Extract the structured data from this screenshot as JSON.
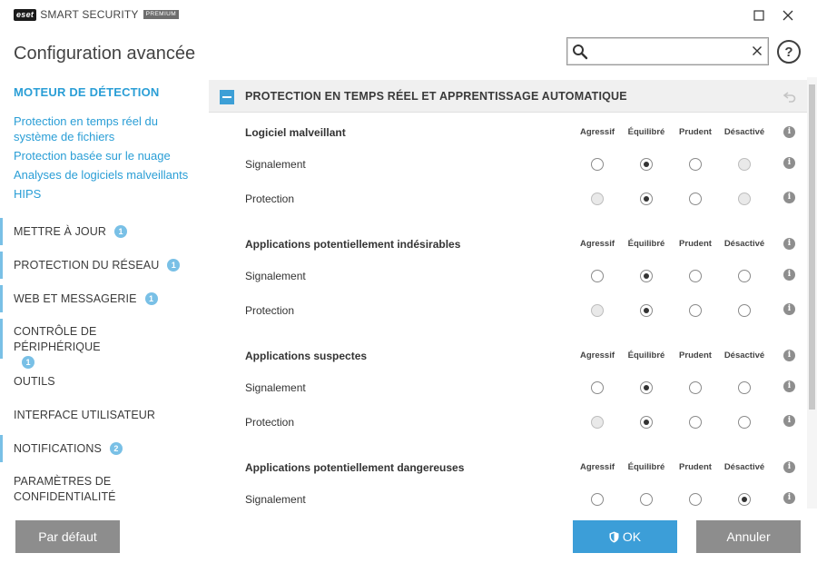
{
  "brand": {
    "logo": "eset",
    "product": "SMART SECURITY",
    "tier": "PREMIUM"
  },
  "window": {
    "maximize_icon": "maximize-icon",
    "close_icon": "close-icon"
  },
  "header": {
    "title": "Configuration avancée",
    "search_value": "",
    "search_placeholder": "",
    "help_label": "?"
  },
  "sidebar": {
    "active_section": "MOTEUR DE DÉTECTION",
    "sub_links": [
      "Protection en temps réel du système de fichiers",
      "Protection basée sur le nuage",
      "Analyses de logiciels malveillants",
      "HIPS"
    ],
    "items": [
      {
        "label": "METTRE À JOUR",
        "badge": "1"
      },
      {
        "label": "PROTECTION DU RÉSEAU",
        "badge": "1"
      },
      {
        "label": "WEB ET MESSAGERIE",
        "badge": "1"
      },
      {
        "label": "CONTRÔLE DE PÉRIPHÉRIQUE",
        "badge": "1"
      },
      {
        "label": "OUTILS",
        "badge": ""
      },
      {
        "label": "INTERFACE UTILISATEUR",
        "badge": ""
      },
      {
        "label": "NOTIFICATIONS",
        "badge": "2"
      },
      {
        "label": "PARAMÈTRES DE CONFIDENTIALITÉ",
        "badge": ""
      }
    ]
  },
  "main": {
    "section_title": "PROTECTION EN TEMPS RÉEL ET APPRENTISSAGE AUTOMATIQUE",
    "columns": [
      "Agressif",
      "Équilibré",
      "Prudent",
      "Désactivé"
    ],
    "info_label": "i",
    "groups": [
      {
        "title": "Logiciel malveillant",
        "rows": [
          {
            "label": "Signalement",
            "selected": 1,
            "disabled": [
              3
            ]
          },
          {
            "label": "Protection",
            "selected": 1,
            "disabled": [
              0,
              3
            ]
          }
        ]
      },
      {
        "title": "Applications potentiellement indésirables",
        "rows": [
          {
            "label": "Signalement",
            "selected": 1,
            "disabled": []
          },
          {
            "label": "Protection",
            "selected": 1,
            "disabled": [
              0
            ]
          }
        ]
      },
      {
        "title": "Applications suspectes",
        "rows": [
          {
            "label": "Signalement",
            "selected": 1,
            "disabled": []
          },
          {
            "label": "Protection",
            "selected": 1,
            "disabled": [
              0
            ]
          }
        ]
      },
      {
        "title": "Applications potentiellement dangereuses",
        "rows": [
          {
            "label": "Signalement",
            "selected": 3,
            "disabled": []
          }
        ]
      }
    ]
  },
  "footer": {
    "default_label": "Par défaut",
    "ok_label": "OK",
    "cancel_label": "Annuler"
  },
  "colors": {
    "accent": "#3c9ed8",
    "link": "#2a9ed6",
    "badge": "#79c0e6",
    "button_grey": "#8d8d8d"
  }
}
